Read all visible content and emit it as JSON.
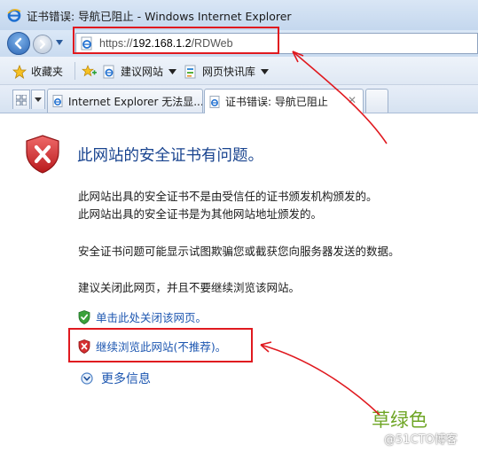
{
  "window": {
    "title": "证书错误: 导航已阻止 - Windows Internet Explorer"
  },
  "address_bar": {
    "protocol": "https://",
    "host": "192.168.1.2",
    "path": "/RDWeb"
  },
  "favorites_bar": {
    "favorites_label": "收藏夹",
    "items": [
      {
        "label": "建议网站",
        "icon": "ie-page-icon"
      },
      {
        "label": "网页快讯库",
        "icon": "web-slice-icon"
      }
    ]
  },
  "tabs": [
    {
      "label": "Internet Explorer 无法显...",
      "active": false
    },
    {
      "label": "证书错误: 导航已阻止",
      "active": true
    }
  ],
  "page": {
    "heading": "此网站的安全证书有问题。",
    "paragraph1_line1": "此网站出具的安全证书不是由受信任的证书颁发机构颁发的。",
    "paragraph1_line2": "此网站出具的安全证书是为其他网站地址颁发的。",
    "paragraph2": "安全证书问题可能显示试图欺骗您或截获您向服务器发送的数据。",
    "paragraph3": "建议关闭此网页，并且不要继续浏览该网站。",
    "close_link": "单击此处关闭该网页。",
    "continue_link": "继续浏览此网站(不推荐)。",
    "more_info": "更多信息"
  },
  "watermark": {
    "author": "草绿色",
    "blog": "@51CTO博客"
  },
  "colors": {
    "heading_blue": "#18438f",
    "link_blue": "#1c56b0",
    "annotation_red": "#e0191f",
    "watermark_green": "#6ea524"
  }
}
